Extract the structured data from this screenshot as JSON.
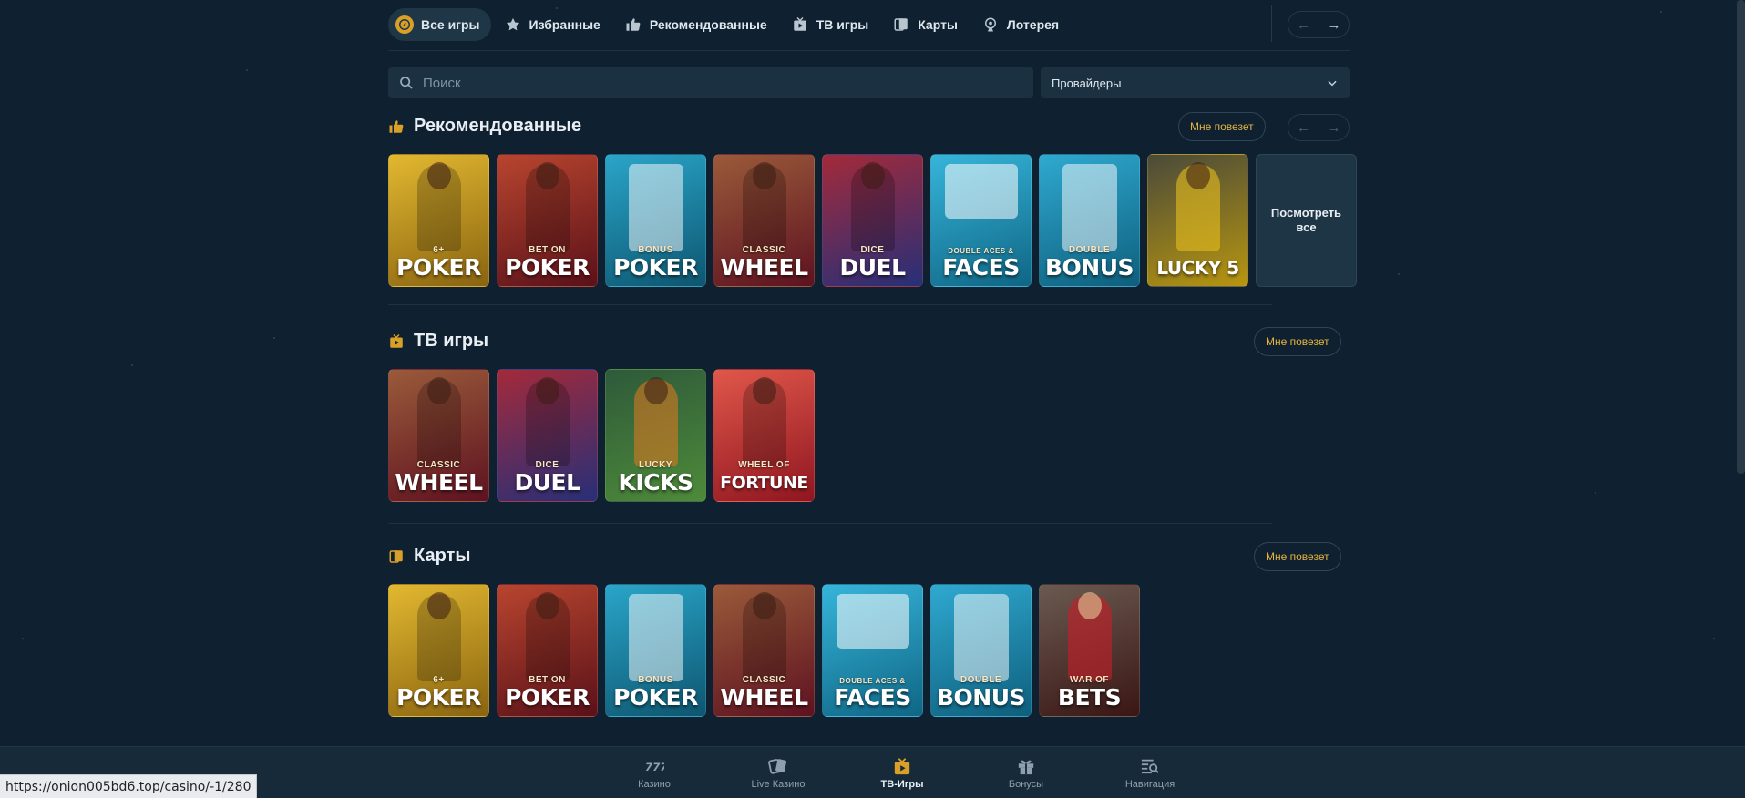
{
  "colors": {
    "background": "#0f2130",
    "accent": "#d9a028",
    "lucky_text": "#e5b33e"
  },
  "tabs": [
    {
      "label": "Все игры",
      "icon": "compass-icon",
      "active": true
    },
    {
      "label": "Избранные",
      "icon": "star-icon"
    },
    {
      "label": "Рекомендованные",
      "icon": "thumbs-up-icon"
    },
    {
      "label": "ТВ игры",
      "icon": "tv-icon"
    },
    {
      "label": "Карты",
      "icon": "cards-icon"
    },
    {
      "label": "Лотерея",
      "icon": "lottery-icon"
    }
  ],
  "search": {
    "placeholder": "Поиск"
  },
  "providers": {
    "label": "Провайдеры"
  },
  "sections": {
    "recommended": {
      "title": "Рекомендованные",
      "lucky": "Мне повезет",
      "view_all": "Посмотреть все",
      "games": [
        {
          "sub": "6+",
          "main": "POKER",
          "color": "#c99a17"
        },
        {
          "sub": "BET ON",
          "main": "POKER",
          "color": "#8a1f2a"
        },
        {
          "sub": "BONUS",
          "main": "POKER",
          "color": "#1b7fa0"
        },
        {
          "sub": "CLASSIC",
          "main": "WHEEL",
          "color": "#8c1f2d"
        },
        {
          "sub": "DICE",
          "main": "DUEL",
          "color": "#2d3a8c"
        },
        {
          "sub": "DOUBLE ACES &",
          "main": "FACES",
          "color": "#1a8bb0"
        },
        {
          "sub": "DOUBLE",
          "main": "BONUS",
          "color": "#1786ab"
        },
        {
          "sub": "",
          "main": "LUCKY 5",
          "color": "#b8960f"
        }
      ]
    },
    "tv": {
      "title": "ТВ игры",
      "lucky": "Мне повезет",
      "games": [
        {
          "sub": "CLASSIC",
          "main": "WHEEL",
          "color": "#8c1f2d"
        },
        {
          "sub": "DICE",
          "main": "DUEL",
          "color": "#2d3a8c"
        },
        {
          "sub": "LUCKY",
          "main": "KICKS",
          "color": "#3f7a34"
        },
        {
          "sub": "WHEEL OF",
          "main": "FORTUNE",
          "color": "#b3232b"
        }
      ]
    },
    "cards": {
      "title": "Карты",
      "lucky": "Мне повезет",
      "games": [
        {
          "sub": "6+",
          "main": "POKER",
          "color": "#c99a17"
        },
        {
          "sub": "BET ON",
          "main": "POKER",
          "color": "#8a1f2a"
        },
        {
          "sub": "BONUS",
          "main": "POKER",
          "color": "#1b7fa0"
        },
        {
          "sub": "CLASSIC",
          "main": "WHEEL",
          "color": "#8c1f2d"
        },
        {
          "sub": "DOUBLE ACES &",
          "main": "FACES",
          "color": "#1a8bb0"
        },
        {
          "sub": "DOUBLE",
          "main": "BONUS",
          "color": "#1786ab"
        },
        {
          "sub": "WAR OF",
          "main": "BETS",
          "color": "#7a2a22"
        }
      ]
    }
  },
  "bottom_nav": [
    {
      "label": "Казино",
      "icon": "casino-777-icon"
    },
    {
      "label": "Live Казино",
      "icon": "live-cards-icon"
    },
    {
      "label": "ТВ-Игры",
      "icon": "tv-icon",
      "active": true
    },
    {
      "label": "Бонусы",
      "icon": "gift-icon"
    },
    {
      "label": "Навигация",
      "icon": "navigation-search-icon"
    }
  ],
  "status_url": "https://onion005bd6.top/casino/-1/280"
}
